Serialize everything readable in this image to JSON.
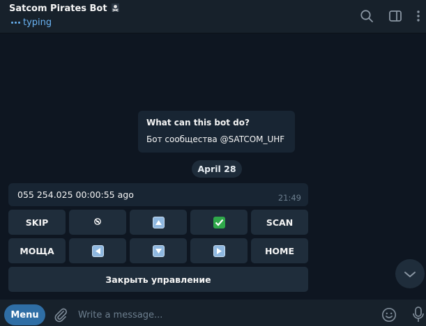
{
  "header": {
    "title": "Satcom Pirates Bot",
    "title_badge_icon": "pirate-flag-icon",
    "status": "typing",
    "actions": [
      "search-icon",
      "sidebar-toggle-icon",
      "more-vertical-icon"
    ]
  },
  "intro": {
    "title": "What can this bot do?",
    "text": "Бот сообщества @SATCOM_UHF"
  },
  "date_separator": "April 28",
  "message": {
    "text": "055 254.025 00:00:55 ago",
    "time": "21:49"
  },
  "keyboard": {
    "rows": [
      [
        {
          "label": "SKIP"
        },
        {
          "label": "",
          "icon": "mute-icon"
        },
        {
          "label": "",
          "icon": "arrow-up-icon"
        },
        {
          "label": "",
          "icon": "check-mark-icon"
        },
        {
          "label": "SCAN"
        }
      ],
      [
        {
          "label": "МОЩА"
        },
        {
          "label": "",
          "icon": "arrow-left-icon"
        },
        {
          "label": "",
          "icon": "arrow-down-icon"
        },
        {
          "label": "",
          "icon": "arrow-right-icon"
        },
        {
          "label": "HOME"
        }
      ]
    ],
    "close_label": "Закрыть управление"
  },
  "composer": {
    "menu_label": "Menu",
    "placeholder": "Write a message..."
  },
  "colors": {
    "background": "#0e1621",
    "header": "#17212b",
    "bubble": "#182533",
    "accent": "#6ab3f3",
    "menu_button": "#2f6ea5"
  }
}
